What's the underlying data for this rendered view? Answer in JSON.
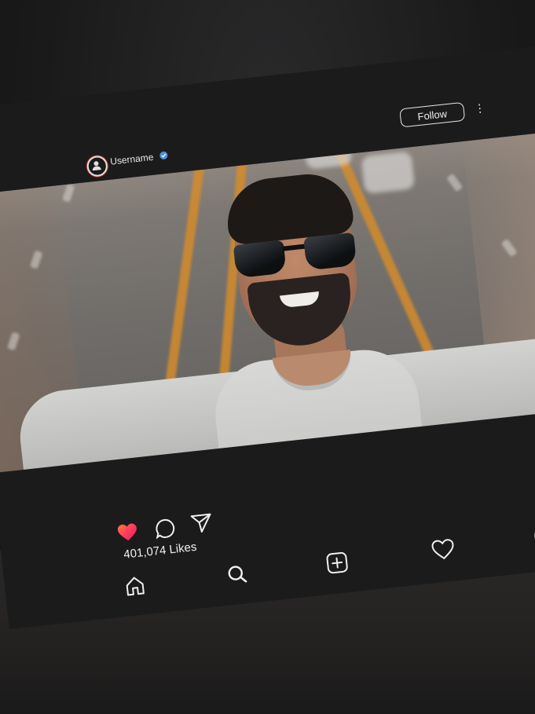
{
  "post": {
    "username": "Username",
    "follow_label": "Follow",
    "more_label": "⋮",
    "likes_text": "401,074 Likes"
  },
  "colors": {
    "card_bg": "#1b1b1c",
    "text": "#f0f0f0",
    "heart_gradient": [
      "#ff5a5f",
      "#ff2a7a"
    ],
    "verified": "#4a90e2"
  },
  "icons": {
    "actions": [
      "heart-filled-icon",
      "comment-icon",
      "share-icon",
      "bookmark-icon"
    ],
    "nav": [
      "home-icon",
      "search-icon",
      "add-post-icon",
      "heart-outline-icon",
      "profile-icon"
    ]
  }
}
